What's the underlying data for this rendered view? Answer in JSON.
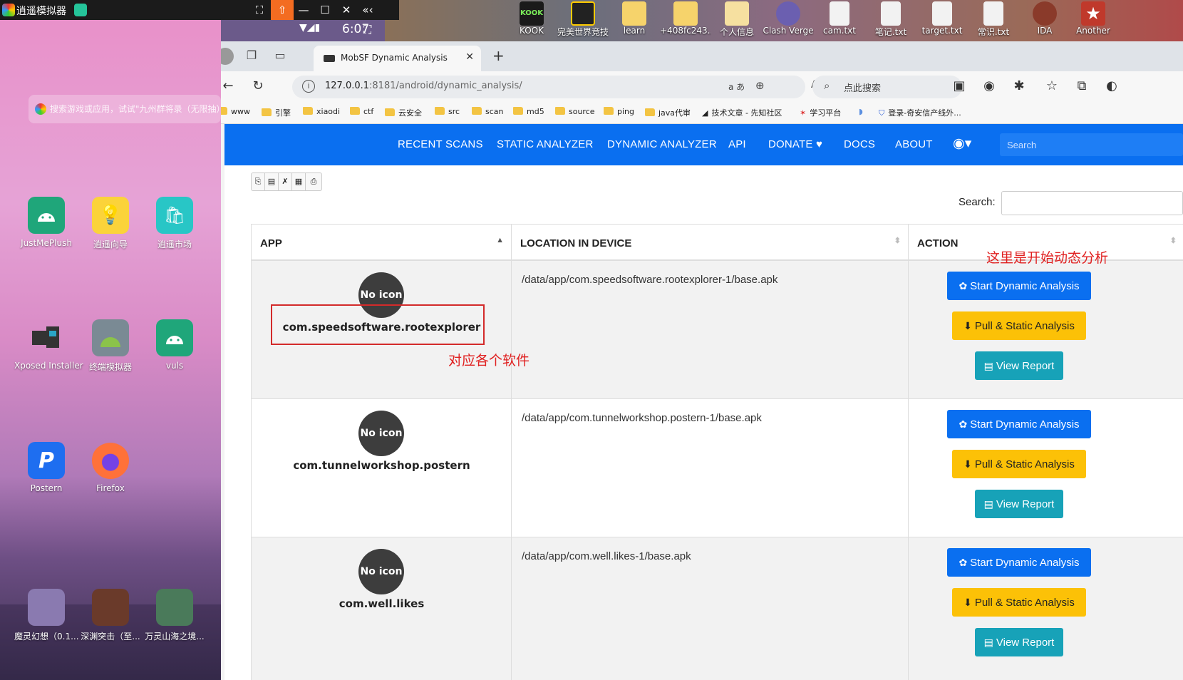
{
  "emulator": {
    "title": "逍遥模拟器",
    "time": "6:07",
    "search_hint": "搜索游戏或应用，试试\"九州群将录（无限抽）\"",
    "apps": [
      {
        "label": "JustMePlush"
      },
      {
        "label": "逍遥向导"
      },
      {
        "label": "逍遥市场"
      },
      {
        "label": "Xposed Installer"
      },
      {
        "label": "终端模拟器"
      },
      {
        "label": "vuls"
      },
      {
        "label": "Postern"
      },
      {
        "label": "Firefox"
      }
    ],
    "dock": [
      {
        "label": "魔灵幻想（0.1..."
      },
      {
        "label": "深渊突击（至..."
      },
      {
        "label": "万灵山海之境..."
      }
    ]
  },
  "desktop": {
    "icons": [
      {
        "label": "KOOK"
      },
      {
        "label": "完美世界竞技平台"
      },
      {
        "label": "learn"
      },
      {
        "label": "+408fc243..."
      },
      {
        "label": "个人信息"
      },
      {
        "label": "Clash Verge"
      },
      {
        "label": "cam.txt"
      },
      {
        "label": "笔记.txt"
      },
      {
        "label": "target.txt"
      },
      {
        "label": "常识.txt"
      },
      {
        "label": "IDA"
      },
      {
        "label": "Another"
      }
    ]
  },
  "browser": {
    "tab_title": "MobSF Dynamic Analysis",
    "url_host": "127.0.0.1",
    "url_path": ":8181/android/dynamic_analysis/",
    "search_pill": "点此搜索",
    "bookmarks": [
      "www",
      "引擎",
      "xiaodi",
      "ctf",
      "云安全",
      "src",
      "scan",
      "md5",
      "source",
      "ping",
      "java代审",
      "技术文章 - 先知社区",
      "学习平台",
      "登录-奇安信产线外..."
    ]
  },
  "mobsf": {
    "nav": [
      "RECENT SCANS",
      "STATIC ANALYZER",
      "DYNAMIC ANALYZER",
      "API",
      "DONATE",
      "DOCS",
      "ABOUT"
    ],
    "search_placeholder": "Search",
    "table_search_label": "Search:",
    "columns": [
      "APP",
      "LOCATION IN DEVICE",
      "ACTION"
    ],
    "no_icon": "No icon",
    "rows": [
      {
        "package": "com.speedsoftware.rootexplorer",
        "location": "/data/app/com.speedsoftware.rootexplorer-1/base.apk"
      },
      {
        "package": "com.tunnelworkshop.postern",
        "location": "/data/app/com.tunnelworkshop.postern-1/base.apk"
      },
      {
        "package": "com.well.likes",
        "location": "/data/app/com.well.likes-1/base.apk"
      }
    ],
    "buttons": {
      "start": "Start Dynamic Analysis",
      "pull": "Pull & Static Analysis",
      "view": "View Report"
    }
  },
  "annotations": {
    "apps_note": "对应各个软件",
    "start_note": "这里是开始动态分析"
  },
  "colors": {
    "primary": "#0a6ff0",
    "warning": "#fcc107",
    "info": "#17a2b8",
    "annotation": "#e02020"
  }
}
